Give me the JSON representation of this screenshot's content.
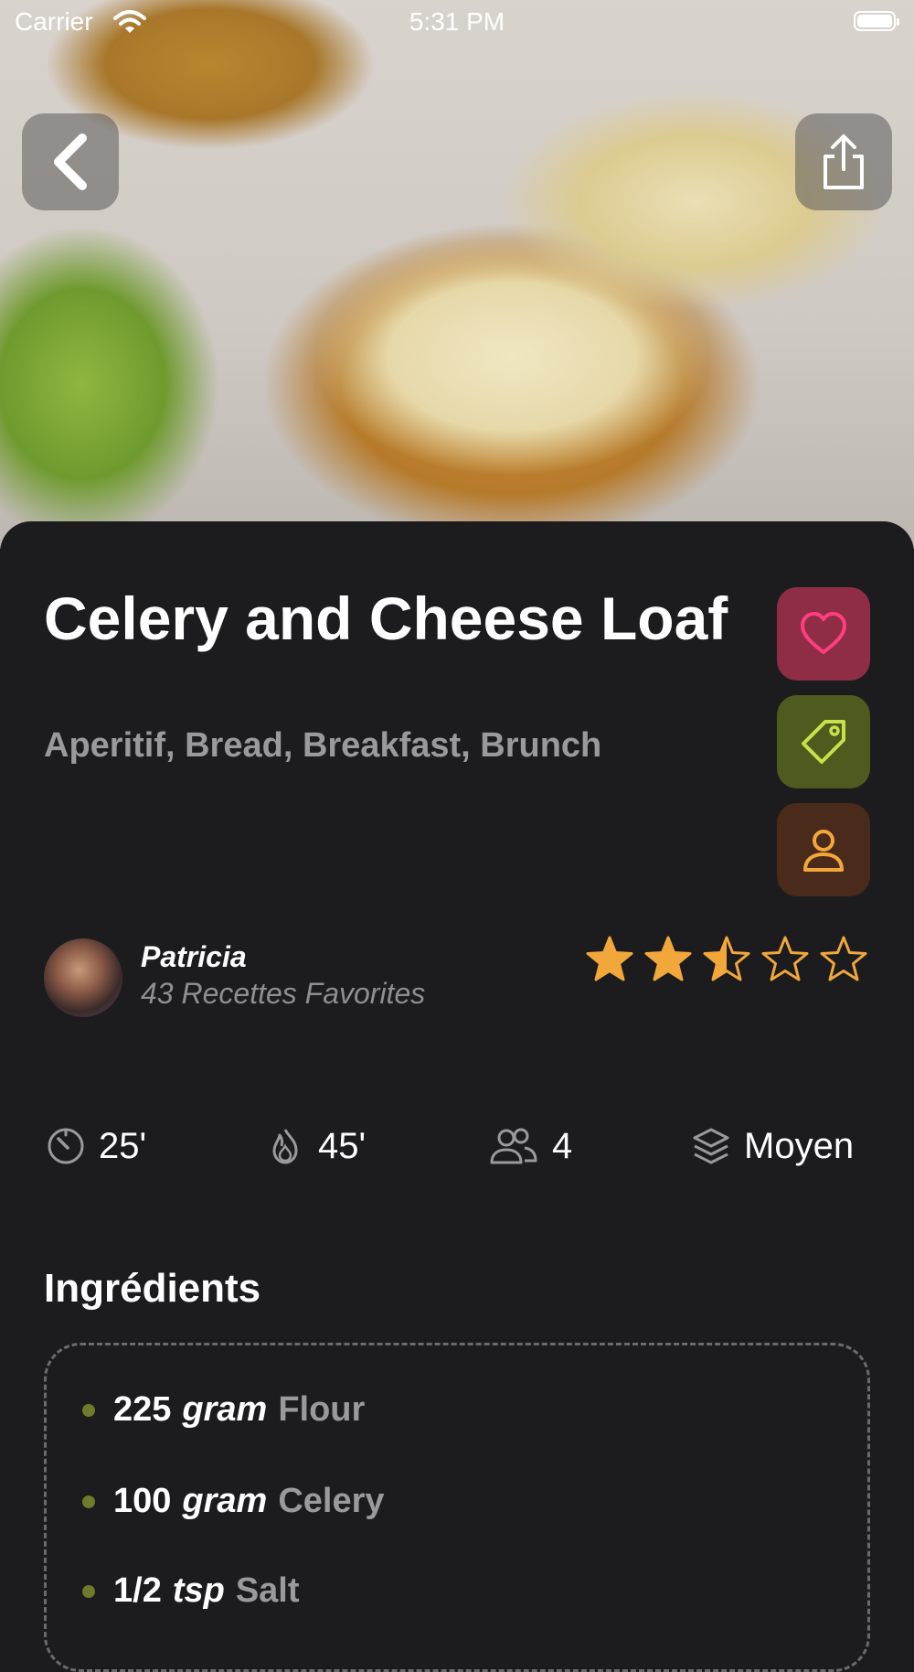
{
  "status_bar": {
    "carrier": "Carrier",
    "time": "5:31 PM"
  },
  "recipe": {
    "title": "Celery and Cheese Loaf",
    "categories": "Aperitif, Bread, Breakfast, Brunch",
    "rating": 2.5,
    "rating_max": 5
  },
  "author": {
    "name": "Patricia",
    "favorites": "43 Recettes Favorites"
  },
  "meta": {
    "prep_time": "25'",
    "cook_time": "45'",
    "servings": "4",
    "difficulty": "Moyen"
  },
  "ingredients_title": "Ingrédients",
  "ingredients": [
    {
      "qty": "225",
      "unit": "gram",
      "name": "Flour"
    },
    {
      "qty": "100",
      "unit": "gram",
      "name": "Celery"
    },
    {
      "qty": "1/2",
      "unit": "tsp",
      "name": "Salt"
    }
  ],
  "colors": {
    "favorite_bg": "#8e2d45",
    "favorite_icon": "#ff3d7f",
    "tag_bg": "#4e5a1e",
    "tag_icon": "#c8e04a",
    "user_bg": "#4a2a1a",
    "user_icon": "#f2a73b",
    "star": "#f2a73b"
  },
  "icons": {
    "back": "chevron-left-icon",
    "share": "share-icon",
    "favorite": "heart-icon",
    "tag": "tag-icon",
    "author": "person-icon",
    "prep": "timer-icon",
    "cook": "flame-icon",
    "servings": "people-icon",
    "difficulty": "layers-icon"
  }
}
